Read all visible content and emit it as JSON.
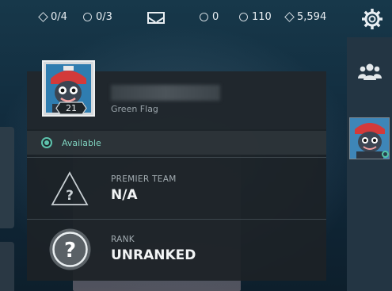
{
  "currencies": {
    "missions": "0/4",
    "weekly": "0/3",
    "vp": "0",
    "radianite": "110",
    "kingdom": "5,594"
  },
  "profile": {
    "level": "21",
    "title": "Green Flag",
    "status": "Available"
  },
  "premier": {
    "label": "PREMIER TEAM",
    "value": "N/A"
  },
  "rank": {
    "label": "RANK",
    "value": "UNRANKED"
  },
  "colors": {
    "status": "#5ec3ad",
    "panel": "#1c2226",
    "rail": "#233543"
  },
  "icons": [
    "missions-icon",
    "weekly-icon",
    "mail-icon",
    "vp-icon",
    "radianite-icon",
    "kingdom-icon",
    "settings-gear-icon",
    "friends-icon",
    "online-status-icon",
    "premier-team-icon",
    "rank-unknown-icon"
  ]
}
